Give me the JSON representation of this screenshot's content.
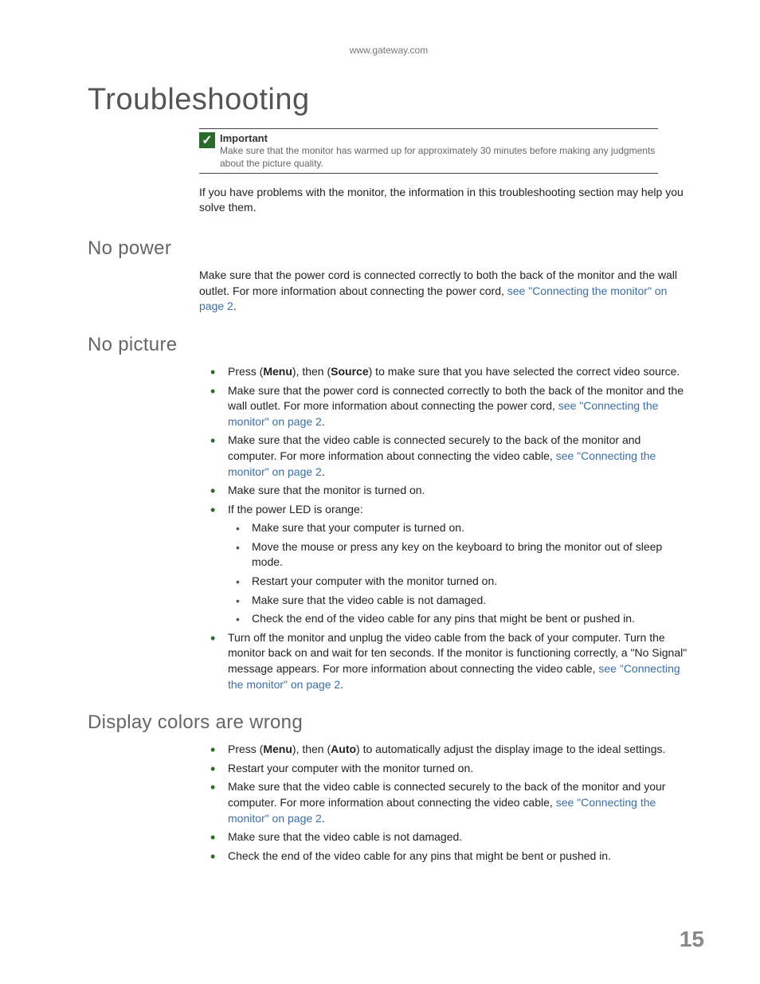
{
  "header_url": "www.gateway.com",
  "title": "Troubleshooting",
  "callout": {
    "label": "Important",
    "text": "Make sure that the monitor has warmed up for approximately 30 minutes before making any judgments about the picture quality."
  },
  "intro": "If you have problems with the monitor, the information in this troubleshooting section may help you solve them.",
  "section1": {
    "heading": "No power",
    "para_pre": "Make sure that the power cord is connected correctly to both the back of the monitor and the wall outlet. For more information about connecting the power cord, ",
    "para_link": "see \"Connecting the monitor\" on page 2",
    "para_post": "."
  },
  "section2": {
    "heading": "No picture",
    "b1_pre": "Press (",
    "b1_menu": "Menu",
    "b1_mid": "), then (",
    "b1_source": "Source",
    "b1_post": ") to make sure that you have selected the correct video source.",
    "b2_pre": "Make sure that the power cord is connected correctly to both the back of the monitor and the wall outlet. For more information about connecting the power cord, ",
    "b2_link": "see \"Connecting the monitor\" on page 2",
    "b2_post": ".",
    "b3_pre": "Make sure that the video cable is connected securely to the back of the monitor and computer. For more information about connecting the video cable, ",
    "b3_link": "see \"Connecting the monitor\" on page 2",
    "b3_post": ".",
    "b4": "Make sure that the monitor is turned on.",
    "b5": "If the power LED is orange:",
    "b5a": "Make sure that your computer is turned on.",
    "b5b": "Move the mouse or press any key on the keyboard to bring the monitor out of sleep mode.",
    "b5c": "Restart your computer with the monitor turned on.",
    "b5d": "Make sure that the video cable is not damaged.",
    "b5e": "Check the end of the video cable for any pins that might be bent or pushed in.",
    "b6_pre": "Turn off the monitor and unplug the video cable from the back of your computer. Turn the monitor back on and wait for ten seconds. If the monitor is functioning correctly, a \"No Signal\" message appears. For more information about connecting the video cable, ",
    "b6_link": "see \"Connecting the monitor\" on page 2",
    "b6_post": "."
  },
  "section3": {
    "heading": "Display colors are wrong",
    "b1_pre": "Press (",
    "b1_menu": "Menu",
    "b1_mid": "), then (",
    "b1_auto": "Auto",
    "b1_post": ") to automatically adjust the display image to the ideal settings.",
    "b2": "Restart your computer with the monitor turned on.",
    "b3_pre": "Make sure that the video cable is connected securely to the back of the monitor and your computer. For more information about connecting the video cable, ",
    "b3_link": "see \"Connecting the monitor\" on page 2",
    "b3_post": ".",
    "b4": "Make sure that the video cable is not damaged.",
    "b5": "Check the end of the video cable for any pins that might be bent or pushed in."
  },
  "page_number": "15"
}
